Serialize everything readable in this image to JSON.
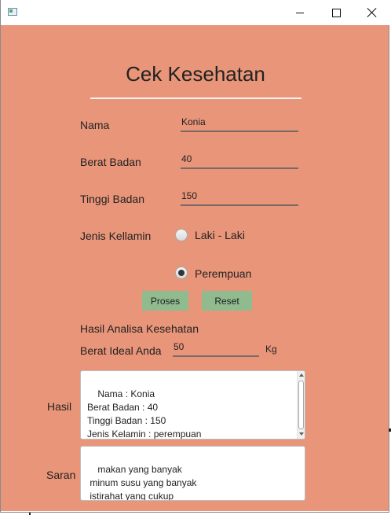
{
  "window": {
    "title": ""
  },
  "heading": "Cek Kesehatan",
  "form": {
    "nama_label": "Nama",
    "nama_value": "Konia",
    "berat_label": "Berat Badan",
    "berat_value": "40",
    "tinggi_label": "Tinggi Badan",
    "tinggi_value": "150",
    "gender_label": "Jenis Kellamin",
    "gender_options": [
      {
        "label": "Laki - Laki",
        "selected": false
      },
      {
        "label": "Perempuan",
        "selected": true
      }
    ]
  },
  "buttons": {
    "proses": "Proses",
    "reset": "Reset"
  },
  "result": {
    "section_label": "Hasil Analisa Kesehatan",
    "ideal_label": "Berat Ideal Anda",
    "ideal_value": "50",
    "ideal_unit": "Kg",
    "hasil_label": "Hasil",
    "hasil_text": "Nama : Konia\nBerat Badan : 40\nTinggi Badan : 150\nJenis Kelamin : perempuan",
    "saran_label": "Saran",
    "saran_text": "makan yang banyak\n minum susu yang banyak\n istirahat yang cukup"
  },
  "colors": {
    "background": "#e99579",
    "button": "#8fbb8f"
  }
}
